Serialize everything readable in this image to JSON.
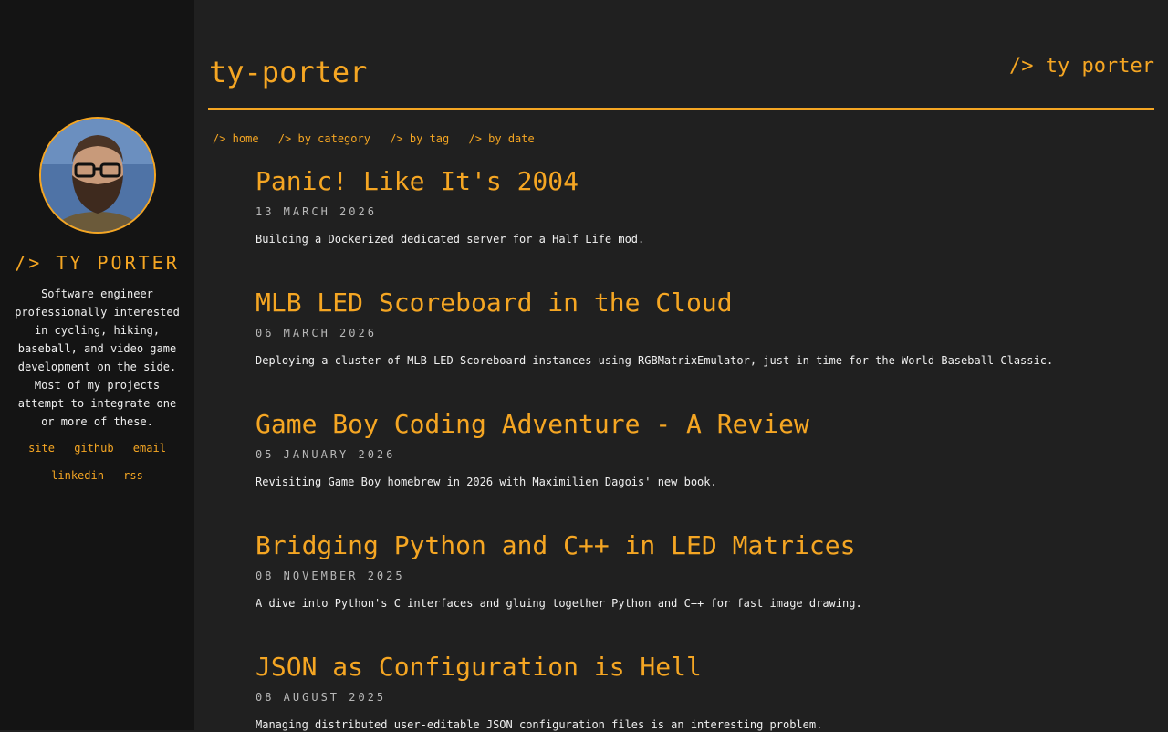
{
  "sidebar": {
    "name": "/> TY PORTER",
    "bio": "Software engineer professionally interested in cycling, hiking, baseball, and video game development on the side. Most of my projects attempt to integrate one or more of these.",
    "links_row1": [
      "site",
      "github",
      "email"
    ],
    "links_row2": [
      "linkedin",
      "rss"
    ]
  },
  "header": {
    "title": "ty-porter",
    "brand": "/> ty porter"
  },
  "nav": [
    "/> home",
    "/> by category",
    "/> by tag",
    "/> by date"
  ],
  "posts": [
    {
      "title": "Panic! Like It's 2004",
      "date": "13 MARCH 2026",
      "description": "Building a Dockerized dedicated server for a Half Life mod."
    },
    {
      "title": "MLB LED Scoreboard in the Cloud",
      "date": "06 MARCH 2026",
      "description": "Deploying a cluster of MLB LED Scoreboard instances using RGBMatrixEmulator, just in time for the World Baseball Classic."
    },
    {
      "title": "Game Boy Coding Adventure - A Review",
      "date": "05 JANUARY 2026",
      "description": "Revisiting Game Boy homebrew in 2026 with Maximilien Dagois' new book."
    },
    {
      "title": "Bridging Python and C++ in LED Matrices",
      "date": "08 NOVEMBER 2025",
      "description": "A dive into Python's C interfaces and gluing together Python and C++ for fast image drawing."
    },
    {
      "title": "JSON as Configuration is Hell",
      "date": "08 AUGUST 2025",
      "description": "Managing distributed user-editable JSON configuration files is an interesting problem."
    }
  ],
  "colors": {
    "accent": "#f5a623",
    "background": "#202020",
    "sidebar": "#141414",
    "text": "#f0f0f0",
    "muted": "#b8b8b8"
  }
}
